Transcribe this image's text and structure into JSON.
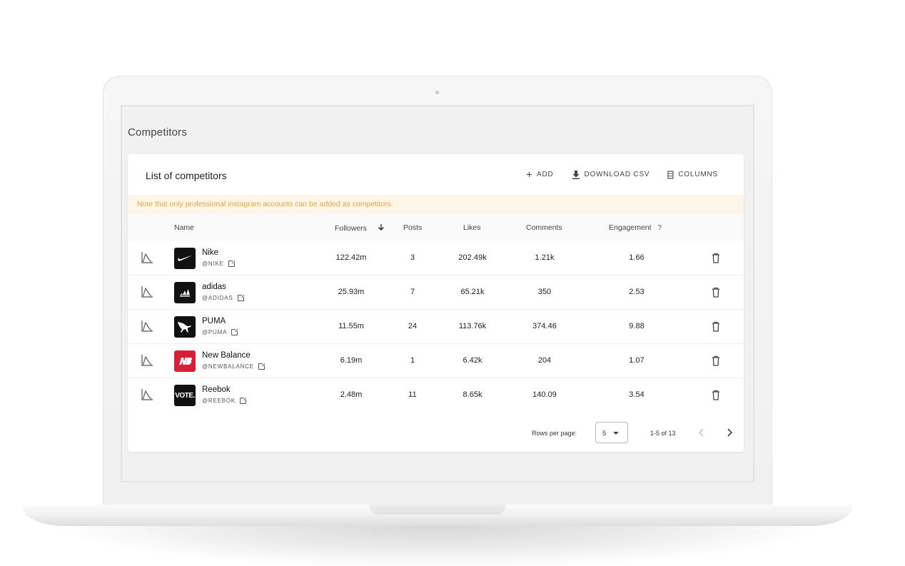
{
  "page": {
    "title": "Competitors"
  },
  "card": {
    "title": "List of competitors",
    "toolbar": {
      "add": "ADD",
      "download": "DOWNLOAD CSV",
      "columns": "COLUMNS"
    },
    "note": "Note that only professional instagram accounts can be added as competitors."
  },
  "table": {
    "headers": {
      "name": "Name",
      "followers": "Followers",
      "posts": "Posts",
      "likes": "Likes",
      "comments": "Comments",
      "engagement": "Engagement",
      "engagement_help": "?"
    },
    "rows": [
      {
        "name": "Nike",
        "handle": "@NIKE",
        "followers": "122.42m",
        "posts": "3",
        "likes": "202.49k",
        "comments": "1.21k",
        "engagement": "1.66",
        "logo": "nike-logo"
      },
      {
        "name": "adidas",
        "handle": "@ADIDAS",
        "followers": "25.93m",
        "posts": "7",
        "likes": "65.21k",
        "comments": "350",
        "engagement": "2.53",
        "logo": "adidas-logo"
      },
      {
        "name": "PUMA",
        "handle": "@PUMA",
        "followers": "11.55m",
        "posts": "24",
        "likes": "113.76k",
        "comments": "374.46",
        "engagement": "9.88",
        "logo": "puma-logo"
      },
      {
        "name": "New Balance",
        "handle": "@NEWBALANCE",
        "followers": "6.19m",
        "posts": "1",
        "likes": "6.42k",
        "comments": "204",
        "engagement": "1.07",
        "logo": "new-balance-logo"
      },
      {
        "name": "Reebok",
        "handle": "@REEBOK",
        "followers": "2.48m",
        "posts": "11",
        "likes": "8.65k",
        "comments": "140.09",
        "engagement": "3.54",
        "logo": "reebok-logo",
        "logo_text": "VOTE."
      }
    ]
  },
  "footer": {
    "rows_per_page_label": "Rows per page:",
    "rows_per_page": "5",
    "range": "1-5 of 13"
  },
  "colors": {
    "note_bg": "#fdf6e8",
    "note_text": "#e8a33c",
    "new_balance": "#d6203a"
  }
}
